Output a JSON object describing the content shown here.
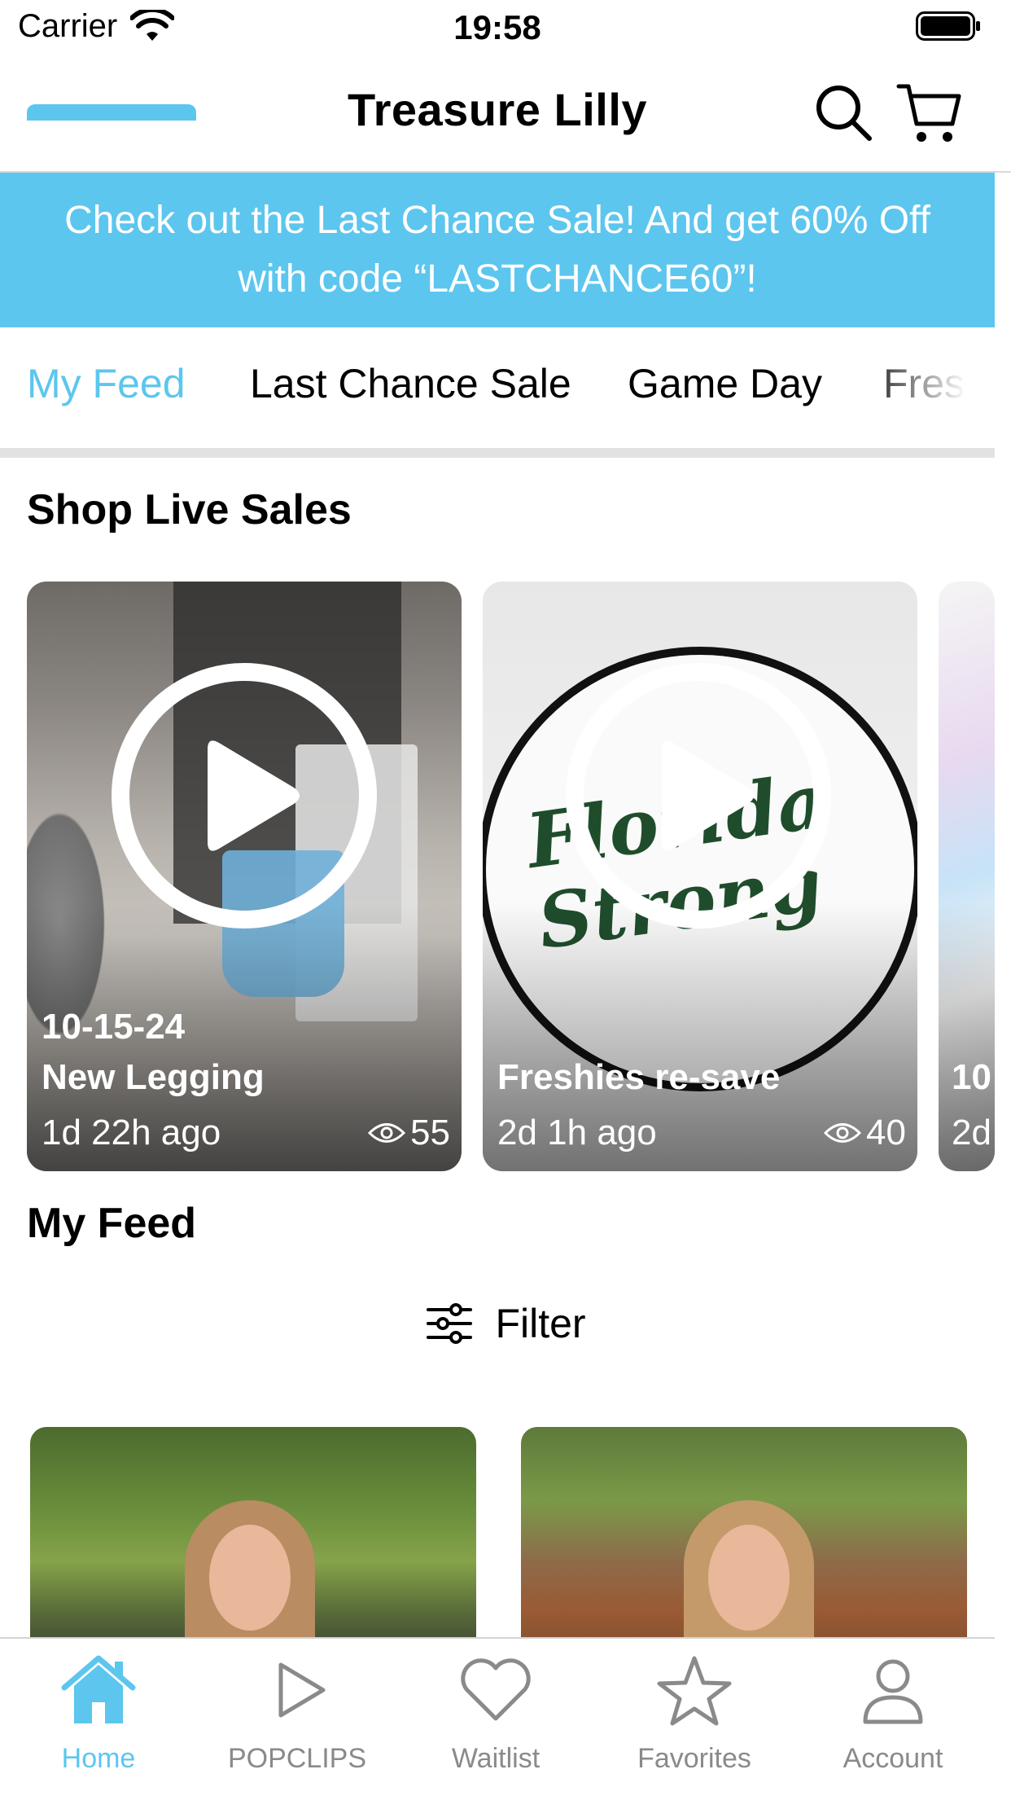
{
  "status_bar": {
    "carrier": "Carrier",
    "time": "19:58"
  },
  "header": {
    "title": "Treasure Lilly",
    "icons": [
      "search-icon",
      "cart-icon"
    ]
  },
  "promo": {
    "text": "Check out the Last Chance Sale!  And get 60% Off\nwith code “LASTCHANCE60”!"
  },
  "tabs": [
    {
      "label": "My Feed",
      "active": true
    },
    {
      "label": "Last Chance Sale"
    },
    {
      "label": "Game Day"
    },
    {
      "label": "Fres"
    }
  ],
  "live_sales": {
    "heading": "Shop Live Sales",
    "cards": [
      {
        "date": "10-15-24",
        "title": "New Legging",
        "time": "1d 22h ago",
        "views": "55"
      },
      {
        "title": "Freshies re-save",
        "time": "2d 1h ago",
        "views": "40",
        "logo_text": "Florida Strong"
      },
      {
        "title": "10",
        "time": "2d"
      }
    ]
  },
  "feed": {
    "heading": "My Feed",
    "filter_label": "Filter"
  },
  "tab_bar": [
    {
      "label": "Home",
      "icon": "home-icon",
      "active": true
    },
    {
      "label": "POPCLIPS",
      "icon": "play-icon"
    },
    {
      "label": "Waitlist",
      "icon": "heart-icon"
    },
    {
      "label": "Favorites",
      "icon": "star-icon"
    },
    {
      "label": "Account",
      "icon": "person-icon"
    }
  ],
  "colors": {
    "accent": "#5cc6ee",
    "inactive": "#8a8a8a"
  }
}
